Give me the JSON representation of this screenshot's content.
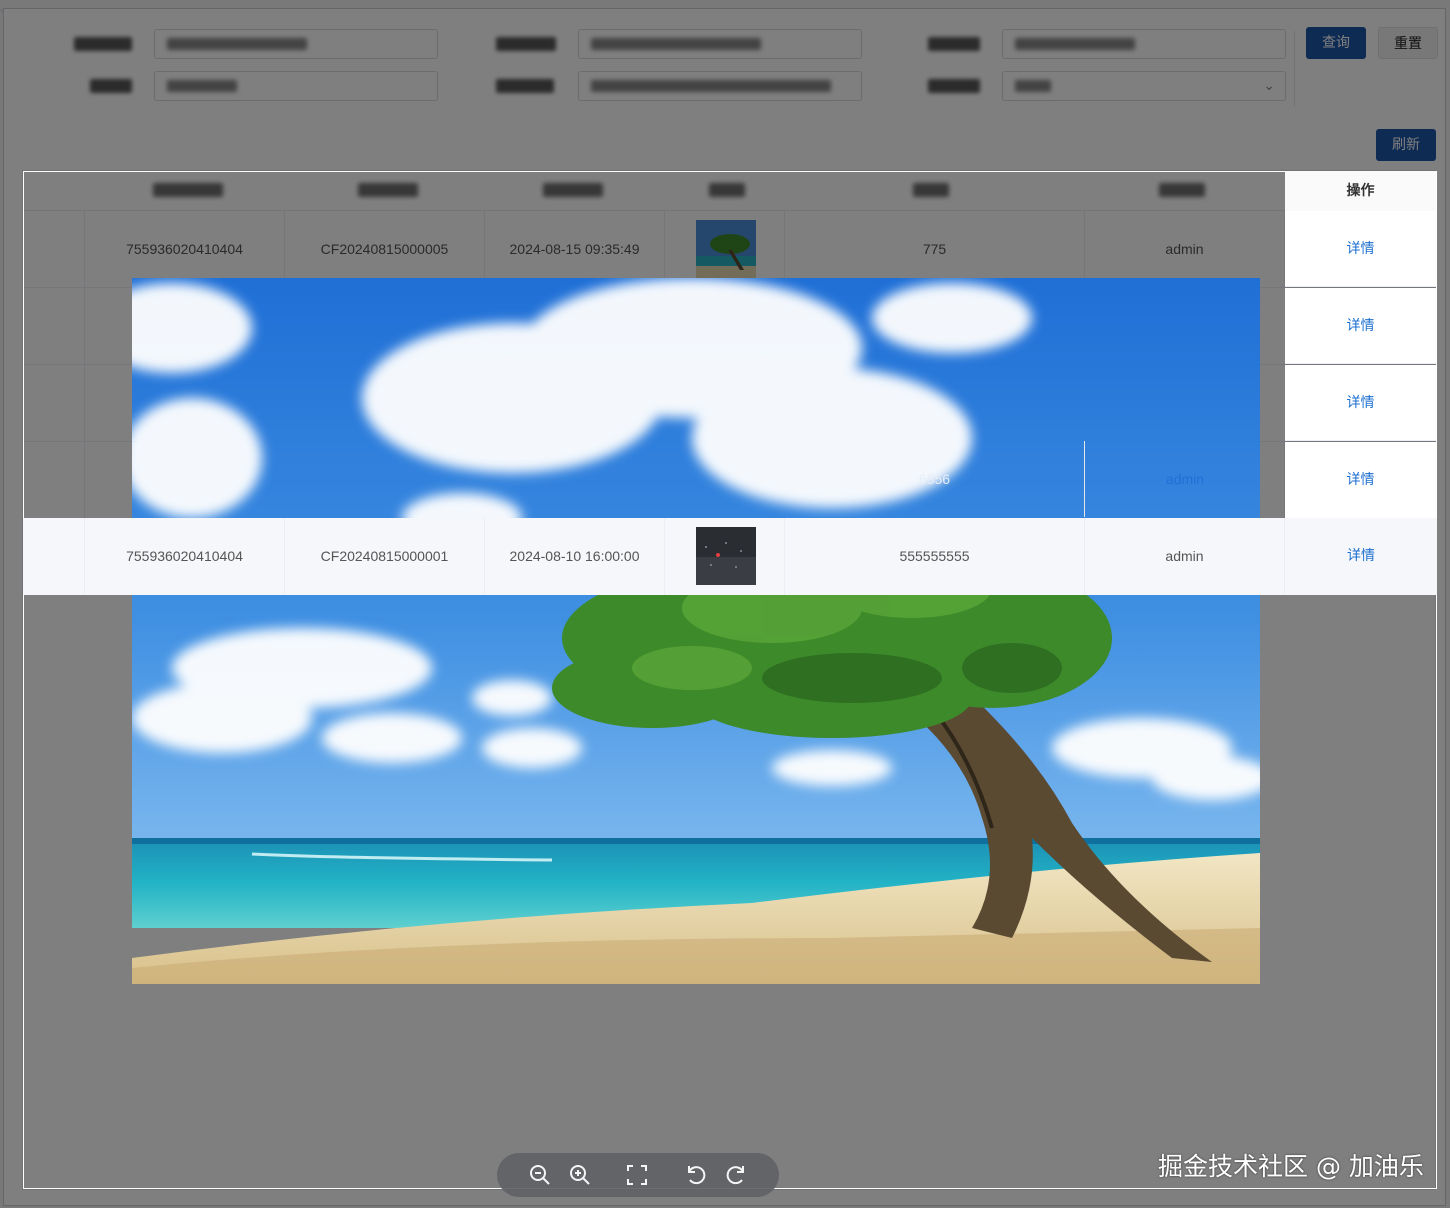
{
  "search": {
    "query_button": "查询",
    "reset_button": "重置"
  },
  "toolbar": {
    "refresh_button": "刷新"
  },
  "table": {
    "operation_header": "操作",
    "rows": [
      {
        "col1": "755936020410404",
        "col2": "CF20240815000005",
        "col3": "2024-08-15 09:35:49",
        "col5": "775",
        "col6": "admin",
        "action": "详情"
      },
      {
        "col1": "7",
        "col2": "",
        "col3": "",
        "col5": "",
        "col6": "",
        "action": "详情"
      },
      {
        "col1": "7",
        "col2": "",
        "col3": "",
        "col5": "",
        "col6": "",
        "action": "详情"
      },
      {
        "col1": "7",
        "col2": "",
        "col3": "",
        "col5": "6556",
        "col6": "admin",
        "action": "详情"
      },
      {
        "col1": "755936020410404",
        "col2": "CF20240815000001",
        "col3": "2024-08-10 16:00:00",
        "col5": "555555555",
        "col6": "admin",
        "action": "详情"
      }
    ]
  },
  "viewer": {
    "tools": [
      {
        "name": "zoom-out-icon"
      },
      {
        "name": "zoom-in-icon"
      },
      {
        "name": "fullscreen-icon"
      },
      {
        "name": "rotate-left-icon"
      },
      {
        "name": "rotate-right-icon"
      }
    ]
  },
  "watermark": "掘金技术社区 @ 加油乐",
  "colors": {
    "primary": "#1d57a9",
    "link": "#1d6fd1",
    "mask": "rgba(0,0,0,0.5)"
  }
}
